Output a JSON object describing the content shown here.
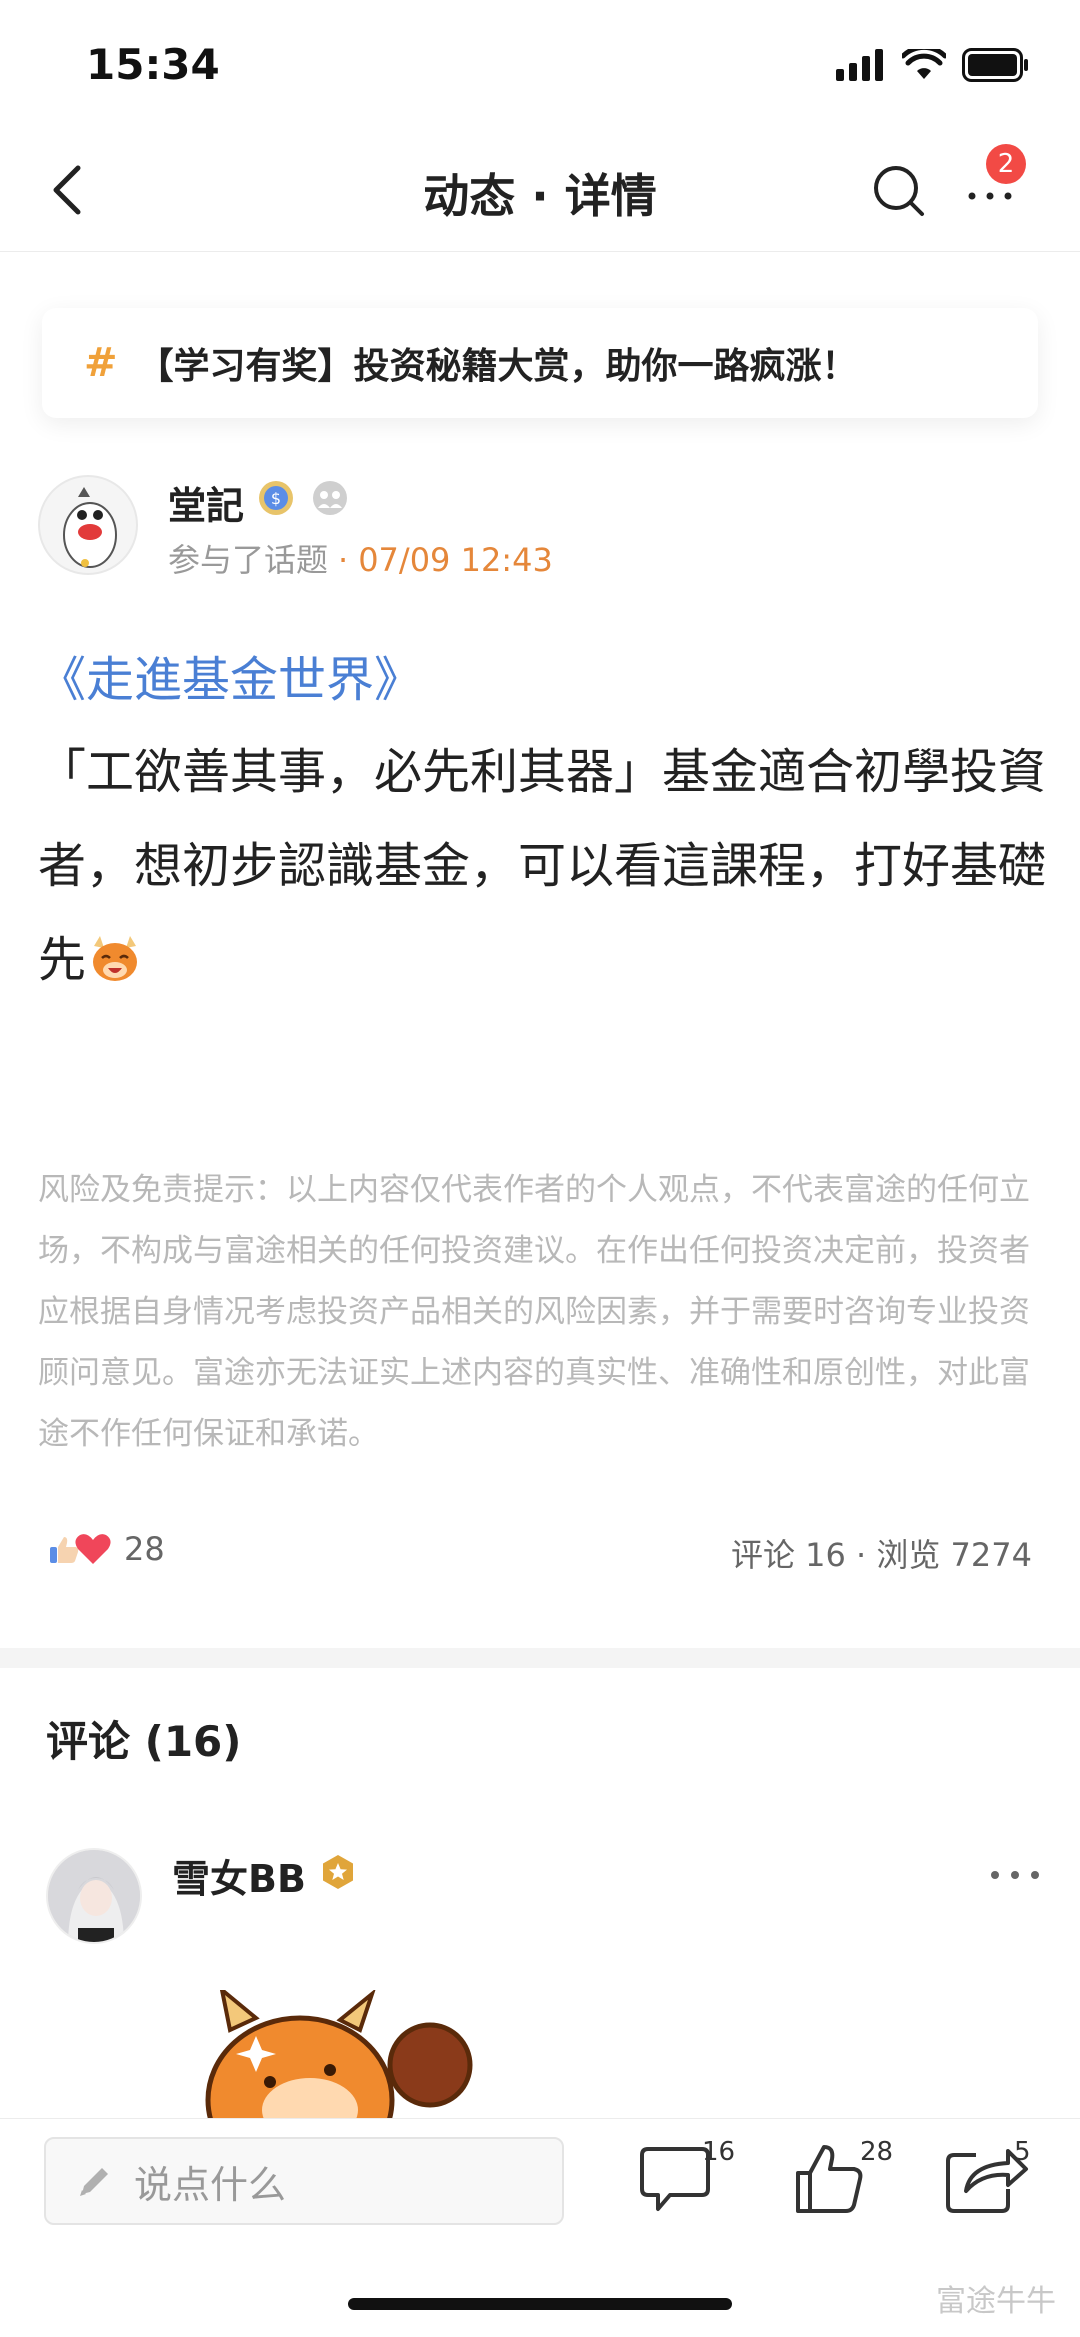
{
  "status_bar": {
    "time": "15:34"
  },
  "nav": {
    "title": "动态 · 详情",
    "badge_count": "2"
  },
  "topic": {
    "hash": "#",
    "text": "【学习有奖】投资秘籍大赏，助你一路疯涨！"
  },
  "author": {
    "name": "堂記",
    "meta_prefix": "参与了话题",
    "meta_dot": "·",
    "time": "07/09 12:43"
  },
  "post": {
    "link_text": "《走進基金世界》",
    "body": "「工欲善其事，必先利其器」基金適合初學投資者，想初步認識基金，可以看這課程，打好基礎先",
    "disclaimer": "风险及免责提示：以上内容仅代表作者的个人观点，不代表富途的任何立场，不构成与富途相关的任何投资建议。在作出任何投资决定前，投资者应根据自身情况考虑投资产品相关的风险因素，并于需要时咨询专业投资顾问意见。富途亦无法证实上述内容的真实性、准确性和原创性，对此富途不作任何保证和承诺。"
  },
  "stats": {
    "like_count": "28",
    "comments_label": "评论 16 · 浏览 7274"
  },
  "comments": {
    "heading": "评论 (16)",
    "first": {
      "user": "雪女BB"
    }
  },
  "bottom_bar": {
    "input_placeholder": "说点什么",
    "comment_count": "16",
    "like_count": "28",
    "share_count": "5"
  },
  "watermark": "富途牛牛",
  "colors": {
    "accent_orange": "#e5873a",
    "link_blue": "#4a7fd4",
    "badge_red": "#f24a45",
    "topic_hash": "#f0a13a"
  }
}
